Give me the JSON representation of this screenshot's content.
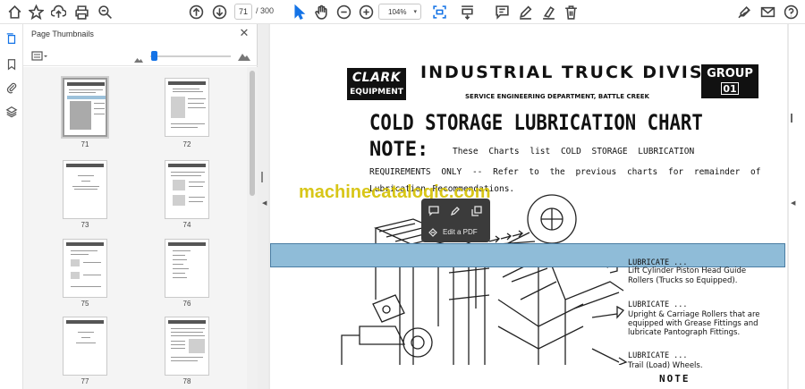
{
  "toolbar": {
    "current_page": "71",
    "page_separator": "/",
    "total_pages": "300",
    "zoom": "104%",
    "icons": [
      "home-icon",
      "bookmark-star-icon",
      "upload-icon",
      "print-icon",
      "zoom-search-icon",
      "page-up-icon",
      "page-down-icon",
      "select-cursor-icon",
      "hand-tool-icon",
      "zoom-out-icon",
      "zoom-in-icon",
      "fit-page-icon",
      "scroll-mode-icon",
      "comment-icon",
      "highlight-pen-icon",
      "erase-icon",
      "delete-icon",
      "sign-icon",
      "mail-icon",
      "help-icon"
    ]
  },
  "rail": {
    "icons": [
      "thumbnails-icon",
      "bookmarks-icon",
      "attachments-icon",
      "layers-icon"
    ]
  },
  "thumbnails_panel": {
    "title": "Page Thumbnails",
    "pages": [
      {
        "label": "71",
        "selected": true
      },
      {
        "label": "72",
        "selected": false
      },
      {
        "label": "73",
        "selected": false
      },
      {
        "label": "74",
        "selected": false
      },
      {
        "label": "75",
        "selected": false
      },
      {
        "label": "76",
        "selected": false
      },
      {
        "label": "77",
        "selected": false
      },
      {
        "label": "78",
        "selected": false
      }
    ]
  },
  "popup": {
    "label": "Edit a PDF"
  },
  "document": {
    "logo_top": "CLARK",
    "logo_bottom": "EQUIPMENT",
    "division_title": "INDUSTRIAL TRUCK DIVISION",
    "department": "SERVICE ENGINEERING DEPARTMENT, BATTLE CREEK",
    "group_label": "GROUP",
    "group_number": "01",
    "chart_title": "COLD STORAGE LUBRICATION CHART",
    "note_word": "NOTE:",
    "note_line1": "These Charts list COLD STORAGE LUBRICATION",
    "note_line2": "REQUIREMENTS ONLY -- Refer to the previous charts for remainder of",
    "note_line3": "Lubrication Recommendations.",
    "watermark": "machinecatalogic.com",
    "lubricate": [
      {
        "head": "LUBRICATE ...",
        "lines": [
          "Lift Cylinder Piston Head Guide",
          "Rollers (Trucks so Equipped)."
        ]
      },
      {
        "head": "LUBRICATE ...",
        "lines": [
          "Upright & Carriage Rollers that are",
          "equipped with Grease Fittings and",
          "lubricate Pantograph Fittings."
        ]
      },
      {
        "head": "LUBRICATE ...",
        "lines": [
          "Trail (Load) Wheels."
        ]
      }
    ],
    "bottom_note": "NOTE"
  },
  "colors": {
    "accent": "#1473e6",
    "band": "#8fbcd8",
    "watermark": "#d4c000",
    "popup_bg": "#3b3b3b"
  }
}
